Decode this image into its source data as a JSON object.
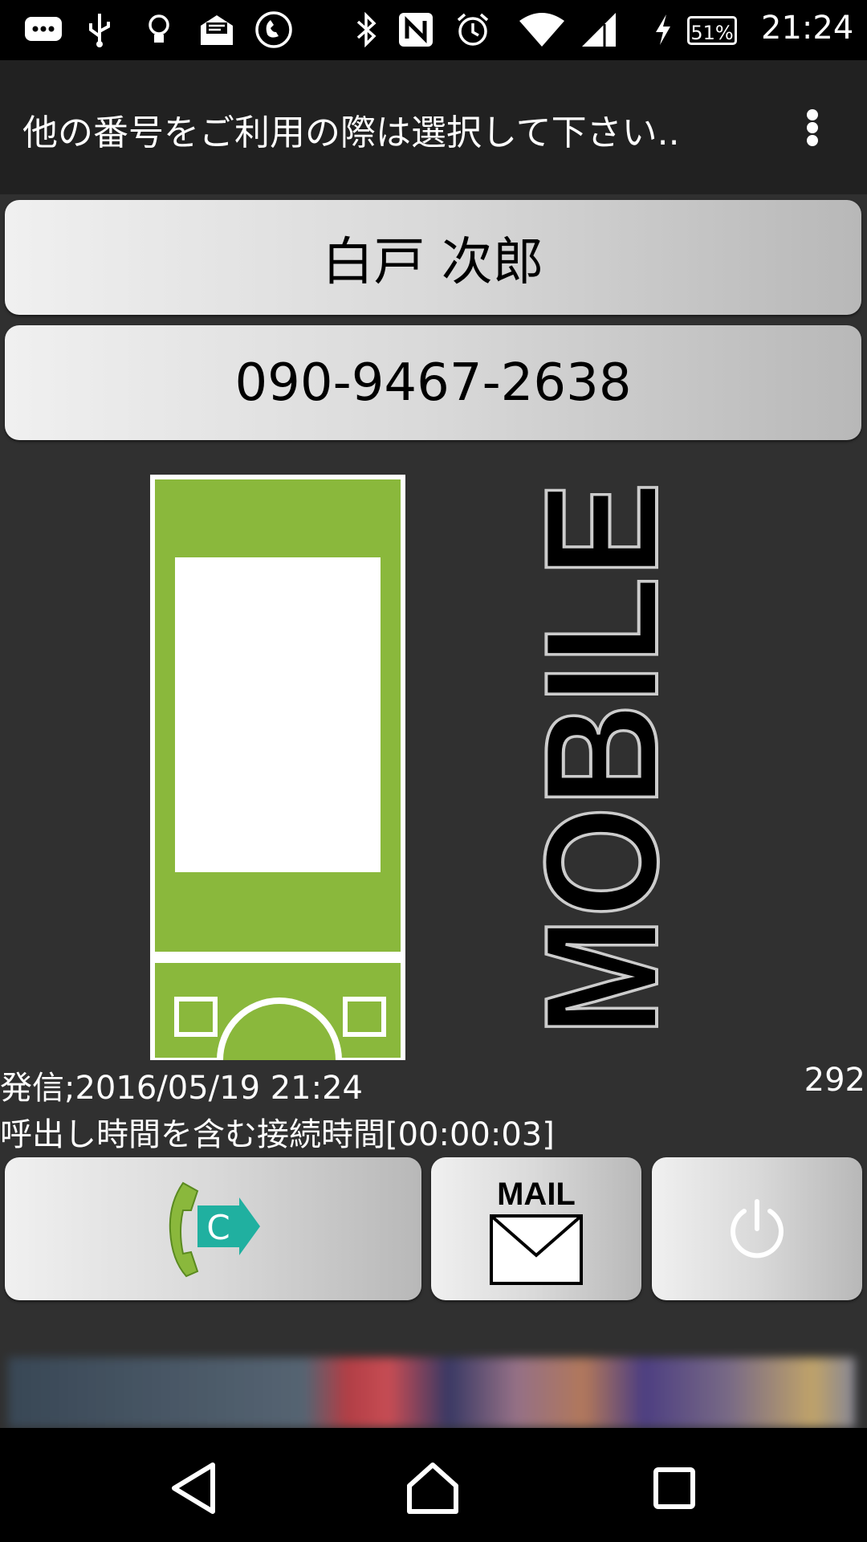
{
  "status_bar": {
    "battery_percent": "51%",
    "time": "21:24",
    "icons": [
      "message-icon",
      "usb-icon",
      "lightbulb-icon",
      "mail-open-icon",
      "call-icon",
      "bluetooth-icon",
      "nfc-icon",
      "alarm-icon",
      "wifi-icon",
      "signal-icon",
      "charging-icon",
      "battery-icon"
    ]
  },
  "app_bar": {
    "title": "他の番号をご利用の際は選択して下さい..",
    "menu_icon": "overflow-menu-icon"
  },
  "contact": {
    "name": "白戸 次郎",
    "number": "090-9467-2638"
  },
  "graphic": {
    "logo_text": "MOBILE",
    "phone_color": "#8ab83c"
  },
  "call": {
    "info": "発信;2016/05/19 21:24",
    "count": "292",
    "duration": "呼出し時間を含む接続時間[00:00:03]"
  },
  "actions": {
    "mail_label": "MAIL",
    "call_badge": "C",
    "icons": [
      "call-c-icon",
      "mail-icon",
      "power-icon"
    ]
  },
  "nav": {
    "icons": [
      "back-icon",
      "home-icon",
      "recents-icon"
    ]
  },
  "colors": {
    "background": "#303030",
    "app_bar": "#212121",
    "accent_green": "#8ab83c",
    "teal": "#20b0a0"
  }
}
